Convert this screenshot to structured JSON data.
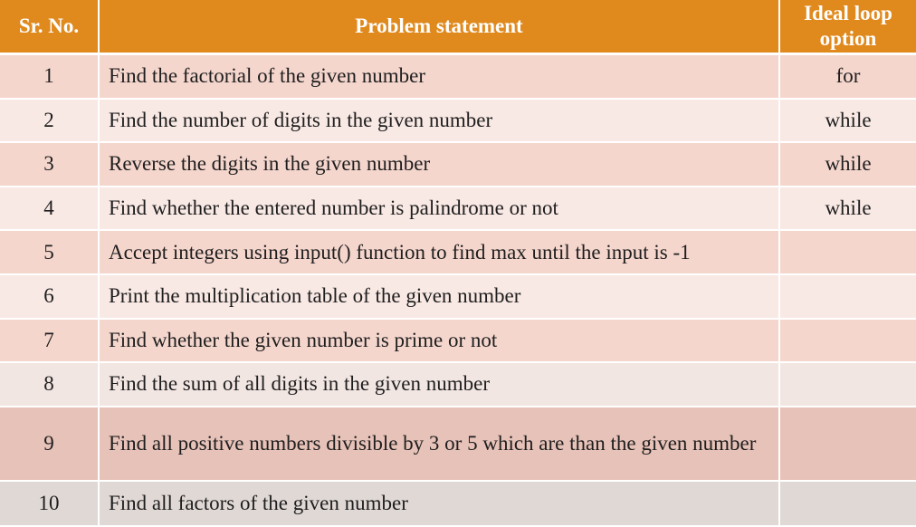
{
  "table": {
    "headers": {
      "sr_no": "Sr. No.",
      "problem": "Problem statement",
      "loop_line1": "Ideal loop",
      "loop_line2": "option"
    },
    "rows": [
      {
        "no": "1",
        "statement": "Find the factorial of the given number",
        "option": "for"
      },
      {
        "no": "2",
        "statement": "Find the number of digits in the given number",
        "option": "while"
      },
      {
        "no": "3",
        "statement": "Reverse the digits in the given number",
        "option": "while"
      },
      {
        "no": "4",
        "statement": "Find whether the entered number is palindrome or not",
        "option": "while"
      },
      {
        "no": "5",
        "statement": "Accept integers using input() function to find max until the input is -1",
        "option": ""
      },
      {
        "no": "6",
        "statement": "Print the multiplication table of the given number",
        "option": ""
      },
      {
        "no": "7",
        "statement": "Find whether the given number is prime or not",
        "option": ""
      },
      {
        "no": "8",
        "statement": "Find the sum of all digits in the given number",
        "option": ""
      },
      {
        "no": "9",
        "statement": "Find all positive numbers divisible by 3 or 5 which are than the given number",
        "option": ""
      },
      {
        "no": "10",
        "statement": "Find all factors of the given number",
        "option": ""
      }
    ]
  }
}
